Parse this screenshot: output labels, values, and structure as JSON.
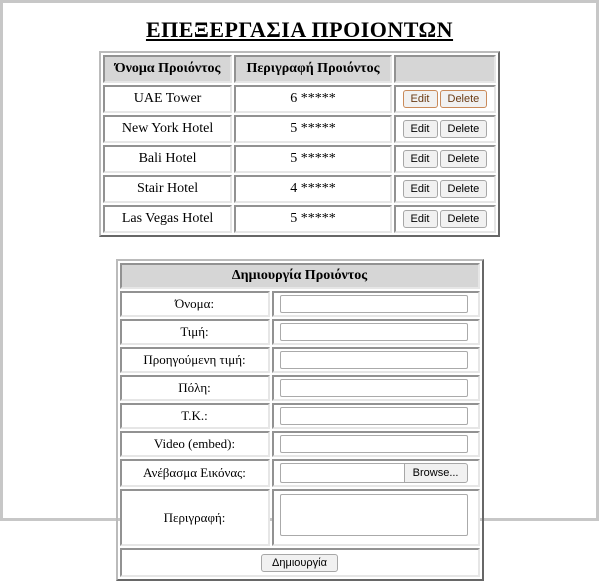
{
  "page_title": "ΕΠΕΞΕΡΓΑΣΙΑ ΠΡΟΙΟΝΤΩΝ",
  "table": {
    "headers": {
      "name": "Όνομα Προιόντος",
      "desc": "Περιγραφή Προιόντος",
      "actions": ""
    },
    "action_labels": {
      "edit": "Edit",
      "delete": "Delete"
    },
    "rows": [
      {
        "name": "UAE Tower",
        "desc": "6 *****"
      },
      {
        "name": "New York Hotel",
        "desc": "5 *****"
      },
      {
        "name": "Bali Hotel",
        "desc": "5 *****"
      },
      {
        "name": "Stair Hotel",
        "desc": "4 *****"
      },
      {
        "name": "Las Vegas Hotel",
        "desc": "5 *****"
      }
    ]
  },
  "form": {
    "caption": "Δημιουργία Προιόντος",
    "fields": {
      "name": "Όνομα:",
      "price": "Τιμή:",
      "prev_price": "Προηγούμενη τιμή:",
      "city": "Πόλη:",
      "zip": "Τ.Κ.:",
      "video": "Video (embed):",
      "image": "Ανέβασμα Εικόνας:",
      "desc": "Περιγραφή:"
    },
    "browse_label": "Browse...",
    "submit_label": "Δημιουργία"
  }
}
